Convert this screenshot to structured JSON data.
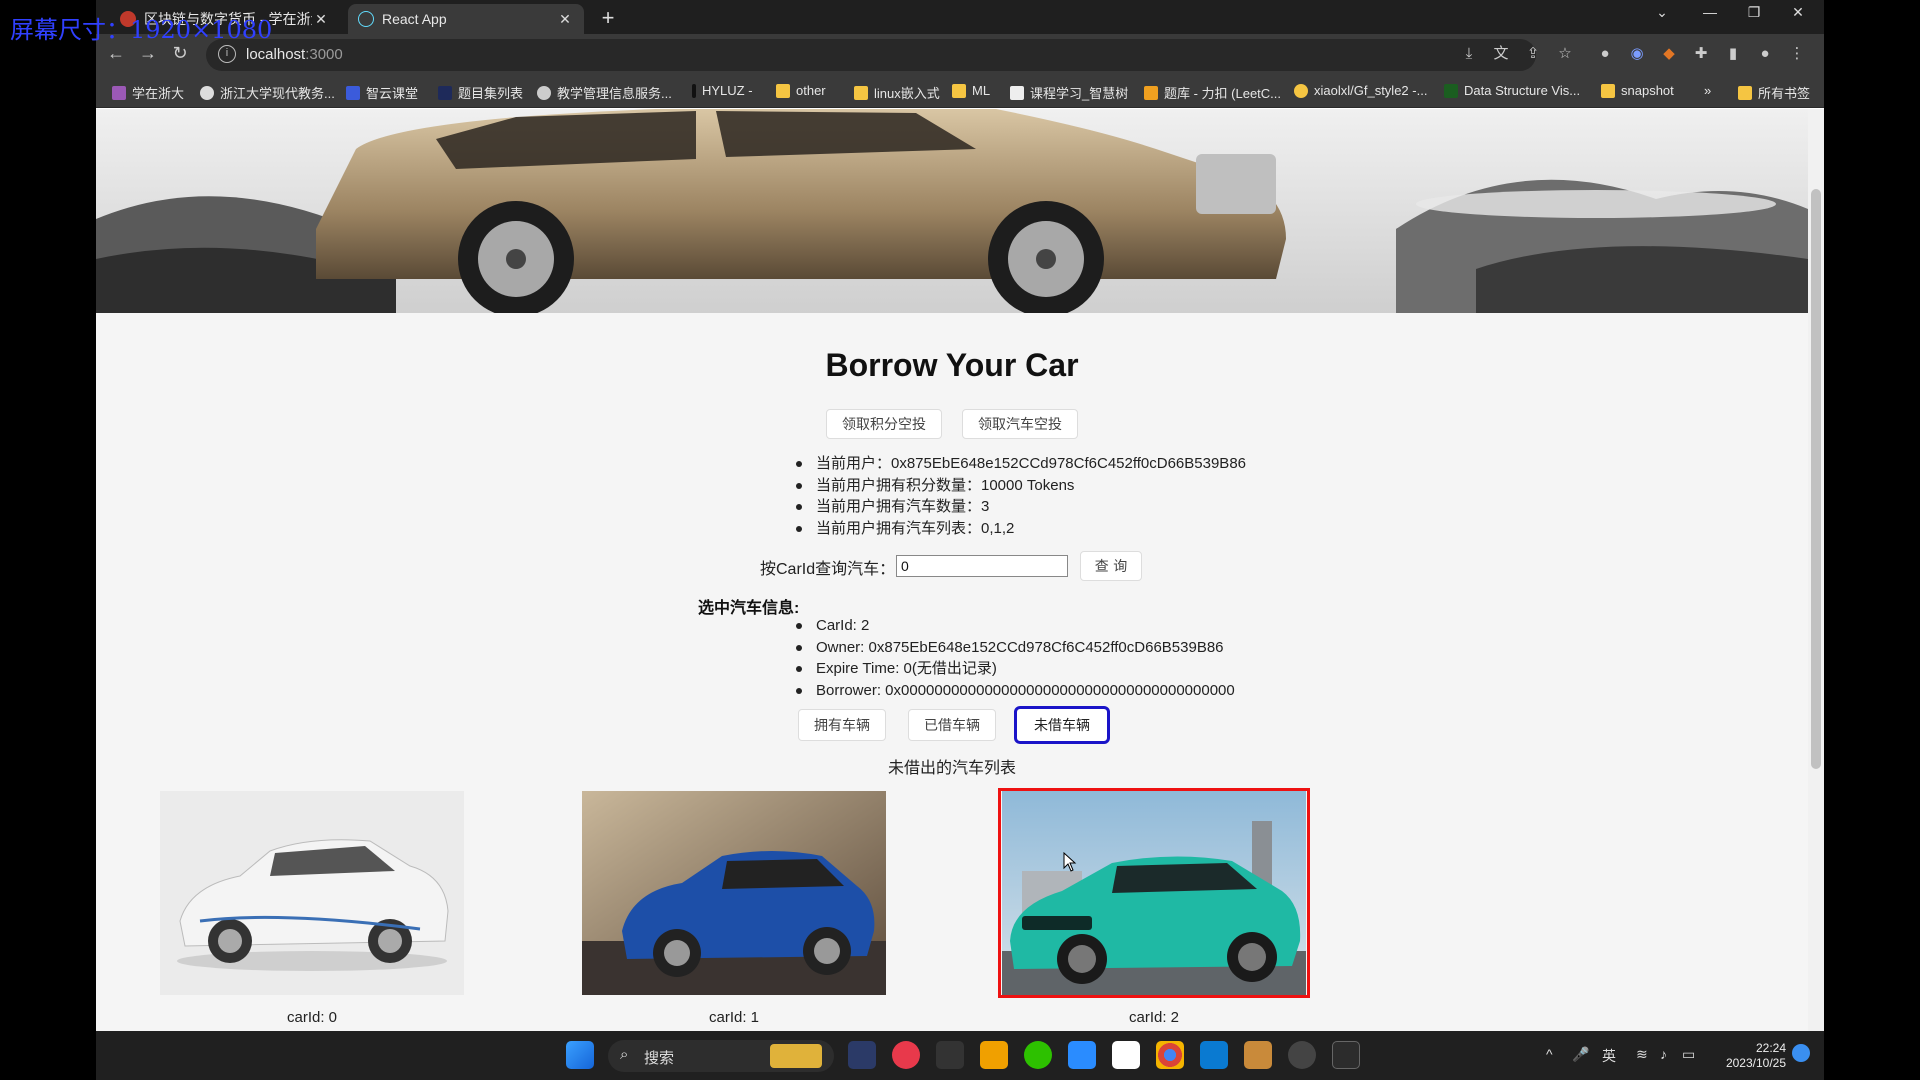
{
  "overlay_label": "屏幕尺寸：1920×1080",
  "browser": {
    "tabs": [
      {
        "label": "区块链与数字货币 - 学在浙大",
        "active": false
      },
      {
        "label": "React App",
        "active": true
      }
    ],
    "url_host": "localhost",
    "url_port": ":3000",
    "bookmarks": [
      "学在浙大",
      "浙江大学现代教务...",
      "智云课堂",
      "题目集列表",
      "教学管理信息服务...",
      "HYLUZ -",
      "other",
      "linux嵌入式",
      "ML",
      "课程学习_智慧树",
      "题库 - 力扣 (LeetC...",
      "xiaolxl/Gf_style2 -...",
      "Data Structure Vis...",
      "snapshot",
      "所有书签"
    ],
    "bookmark_overflow": "»"
  },
  "app": {
    "title": "Borrow Your Car",
    "buttons": {
      "claim_points": "领取积分空投",
      "claim_car": "领取汽车空投",
      "query": "查 询",
      "owned": "拥有车辆",
      "borrowed": "已借车辆",
      "available": "未借车辆"
    },
    "user_info": [
      "当前用户：0x875EbE648e152CCd978Cf6C452ff0cD66B539B86",
      "当前用户拥有积分数量：10000 Tokens",
      "当前用户拥有汽车数量：3",
      "当前用户拥有汽车列表：0,1,2"
    ],
    "query_label": "按CarId查询汽车：",
    "query_value": "0",
    "selected_heading": "选中汽车信息:",
    "selected_info": [
      "CarId: 2",
      "Owner: 0x875EbE648e152CCd978Cf6C452ff0cD66B539B86",
      "Expire Time: 0(无借出记录)",
      "Borrower: 0x0000000000000000000000000000000000000000"
    ],
    "list_title": "未借出的汽车列表",
    "cars": [
      {
        "label": "carId: 0"
      },
      {
        "label": "carId: 1"
      },
      {
        "label": "carId: 2",
        "selected": true
      }
    ]
  },
  "taskbar": {
    "search_placeholder": "搜索",
    "ime": "英",
    "time": "22:24",
    "date": "2023/10/25"
  }
}
